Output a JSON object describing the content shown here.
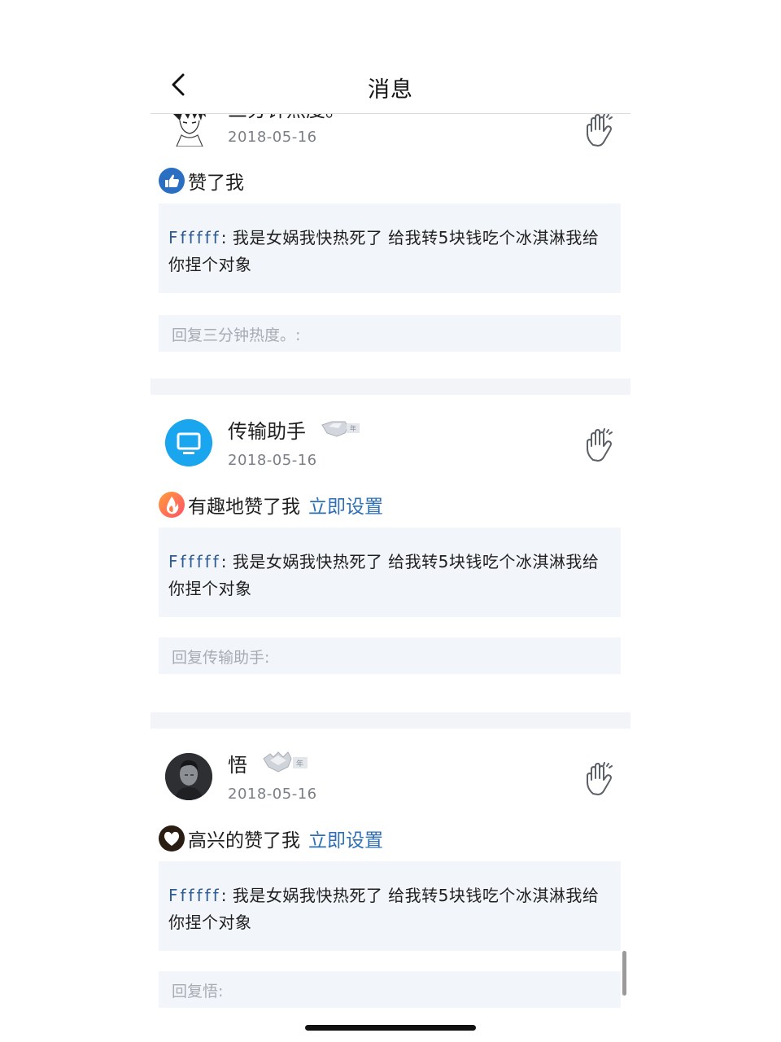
{
  "nav": {
    "title": "消息",
    "back_icon": "chevron-left-icon"
  },
  "messages": [
    {
      "user": "三分钟热度。",
      "date": "2018-05-16",
      "avatar": "anime-avatar",
      "action_icon": "thumbs-up-icon",
      "action": "赞了我",
      "action_link": "",
      "quote_author": "Ffffff",
      "quote_text": ": 我是女娲我快热死了 给我转5块钱吃个冰淇淋我给你捏个对象",
      "reply_placeholder": "回复三分钟热度。:"
    },
    {
      "user": "传输助手",
      "date": "2018-05-16",
      "avatar": "monitor-icon",
      "badge": "level-badge",
      "action_icon": "flame-icon",
      "action": "有趣地赞了我",
      "action_link": "立即设置",
      "quote_author": "Ffffff",
      "quote_text": ": 我是女娲我快热死了 给我转5块钱吃个冰淇淋我给你捏个对象",
      "reply_placeholder": "回复传输助手:"
    },
    {
      "user": "悟",
      "date": "2018-05-16",
      "avatar": "dark-portrait-avatar",
      "badge": "level-badge",
      "action_icon": "heart-icon",
      "action": "高兴的赞了我",
      "action_link": "立即设置",
      "quote_author": "Ffffff",
      "quote_text": ": 我是女娲我快热死了 给我转5块钱吃个冰淇淋我给你捏个对象",
      "reply_placeholder": "回复悟:"
    }
  ],
  "colors": {
    "link": "#2f6fb5",
    "quote_author": "#2f5d93",
    "panel_bg": "#f2f5f9",
    "thumb_blue": "#2b6fc2"
  }
}
